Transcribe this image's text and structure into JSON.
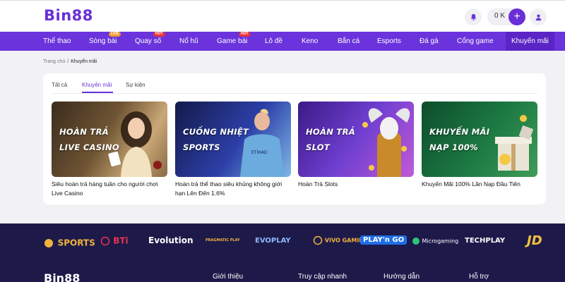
{
  "header": {
    "logo": "Bin88",
    "balance": "0 K",
    "plus": "+"
  },
  "nav": {
    "items": [
      {
        "label": "Thể thao"
      },
      {
        "label": "Sòng bài",
        "badge": "LIVE"
      },
      {
        "label": "Quay số",
        "badge": "HOT"
      },
      {
        "label": "Nổ hũ"
      },
      {
        "label": "Game bài",
        "badge": "HOT"
      },
      {
        "label": "Lô đề"
      },
      {
        "label": "Keno"
      },
      {
        "label": "Bắn cá"
      },
      {
        "label": "Esports"
      },
      {
        "label": "Đá gà"
      },
      {
        "label": "Cổng game"
      },
      {
        "label": "Khuyến mãi",
        "active": true
      }
    ]
  },
  "breadcrumb": {
    "home": "Trang chủ",
    "separator": "/",
    "current": "Khuyến mãi"
  },
  "tabs": [
    {
      "label": "Tất cả"
    },
    {
      "label": "Khuyến mãi",
      "active": true
    },
    {
      "label": "Sự kiện"
    }
  ],
  "promos": [
    {
      "line1": "HOÀN TRẢ",
      "line2": "LIVE CASINO",
      "caption": "Siêu hoàn trả hàng tuần cho người chơi Live Casino"
    },
    {
      "line1": "CUỒNG NHIỆT",
      "line2": "SPORTS",
      "caption": "Hoàn trả thể thao siêu khủng không giới hạn Lên Đến 1.6%"
    },
    {
      "line1": "HOÀN TRẢ",
      "line2": "SLOT",
      "caption": "Hoàn Trả Slots"
    },
    {
      "line1": "KHUYẾN MÃI",
      "line2": "NẠP 100%",
      "caption": "Khuyến Mãi 100% Lần Nạp Đầu Tiên"
    }
  ],
  "partners": [
    "SPORTS",
    "BTi",
    "Evolution",
    "PRAGMATIC PLAY",
    "EVOPLAY",
    "VIVO GAMING",
    "PLAY'n GO",
    "Microgaming",
    "TECHPLAY",
    "JD"
  ],
  "footer": {
    "logo": "Bin88",
    "columns": [
      "Giới thiệu",
      "Truy cập nhanh",
      "Hướng dẫn",
      "Hỗ trợ"
    ]
  },
  "colors": {
    "brand": "#6a33dc",
    "footer": "#1d1a4a"
  }
}
